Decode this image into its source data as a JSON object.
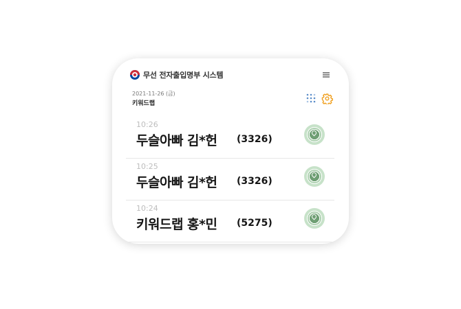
{
  "header": {
    "title": "무선 전자출입명부 시스템"
  },
  "info": {
    "date": "2021-11-26 (금)",
    "place": "키워드랩"
  },
  "entries": [
    {
      "time": "10:26",
      "name": "두슬아빠  김*헌",
      "code": "(3326)"
    },
    {
      "time": "10:25",
      "name": "두슬아빠  김*헌",
      "code": "(3326)"
    },
    {
      "time": "10:24",
      "name": "키워드랩  홍*민",
      "code": "(5275)"
    }
  ],
  "colors": {
    "accent": "#f0a020",
    "logo_red": "#cd2e3a",
    "logo_blue": "#0047a0",
    "location_green": "#6f9f74",
    "grid_blue": "#5b8dc9"
  }
}
